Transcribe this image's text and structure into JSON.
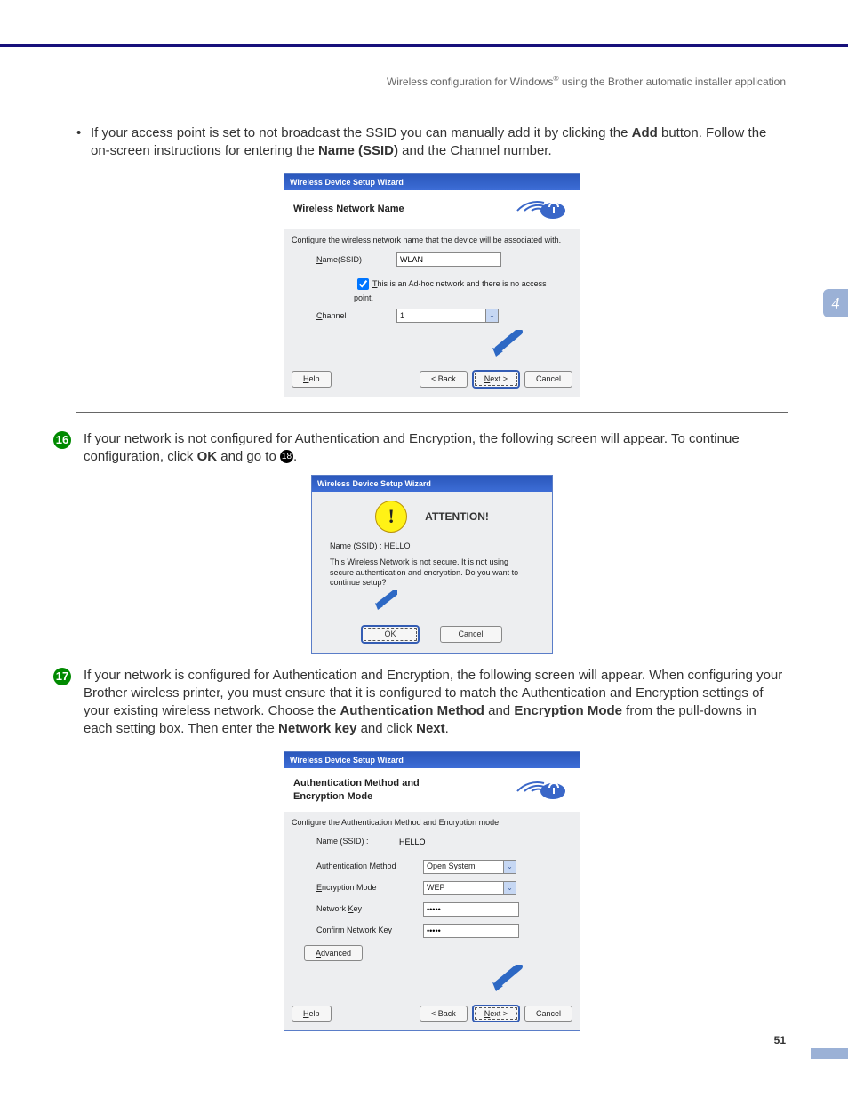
{
  "header": {
    "breadcrumb_pre": "Wireless configuration for Windows",
    "breadcrumb_sup": "®",
    "breadcrumb_post": " using the Brother automatic installer application"
  },
  "side_tab": "4",
  "page_number": "51",
  "intro": {
    "t1": "If your access point is set to not broadcast the SSID you can manually add it by clicking the ",
    "b1": "Add",
    "t2": " button. Follow the on-screen instructions for entering the ",
    "b2": "Name (SSID)",
    "t3": " and the Channel number."
  },
  "step16": {
    "n": "16",
    "t1": "If your network is not configured for Authentication and Encryption, the following screen will appear. To continue configuration, click ",
    "b1": "OK",
    "t2": " and go to ",
    "ref": "18",
    "t3": "."
  },
  "step17": {
    "n": "17",
    "t1": "If your network is configured for Authentication and Encryption, the following screen will appear. When configuring your Brother wireless printer, you must ensure that it is configured to match the Authentication and Encryption settings of your existing wireless network. Choose the ",
    "b1": "Authentication Method",
    "t2": " and ",
    "b2": "Encryption Mode",
    "t3": " from the pull-downs in each setting box. Then enter the ",
    "b3": "Network key",
    "t4": " and click ",
    "b4": "Next",
    "t5": "."
  },
  "dlg1": {
    "title": "Wireless Device Setup Wizard",
    "heading": "Wireless Network Name",
    "sub": "Configure the wireless network name that the device will be associated with.",
    "name_lbl": "Name(SSID)",
    "name_val": "WLAN",
    "chk": "This is an Ad-hoc network and there is no access point.",
    "channel_lbl": "Channel",
    "channel_val": "1",
    "help": "Help",
    "back": "< Back",
    "next": "Next >",
    "cancel": "Cancel"
  },
  "dlg2": {
    "title": "Wireless Device Setup Wizard",
    "att": "ATTENTION!",
    "ssid_line": "Name (SSID) : HELLO",
    "msg": "This Wireless Network is not secure. It is not using secure authentication and encryption. Do you want to continue setup?",
    "ok": "OK",
    "cancel": "Cancel"
  },
  "dlg3": {
    "title": "Wireless Device Setup Wizard",
    "heading": "Authentication Method and Encryption Mode",
    "sub": "Configure the Authentication Method and Encryption mode",
    "ssid_lbl": "Name (SSID) :",
    "ssid_val": "HELLO",
    "auth_lbl": "Authentication Method",
    "auth_val": "Open System",
    "enc_lbl": "Encryption Mode",
    "enc_val": "WEP",
    "key_lbl": "Network Key",
    "key_val": "•••••",
    "ckey_lbl": "Confirm Network Key",
    "ckey_val": "•••••",
    "advanced": "Advanced",
    "help": "Help",
    "back": "< Back",
    "next": "Next >",
    "cancel": "Cancel"
  }
}
